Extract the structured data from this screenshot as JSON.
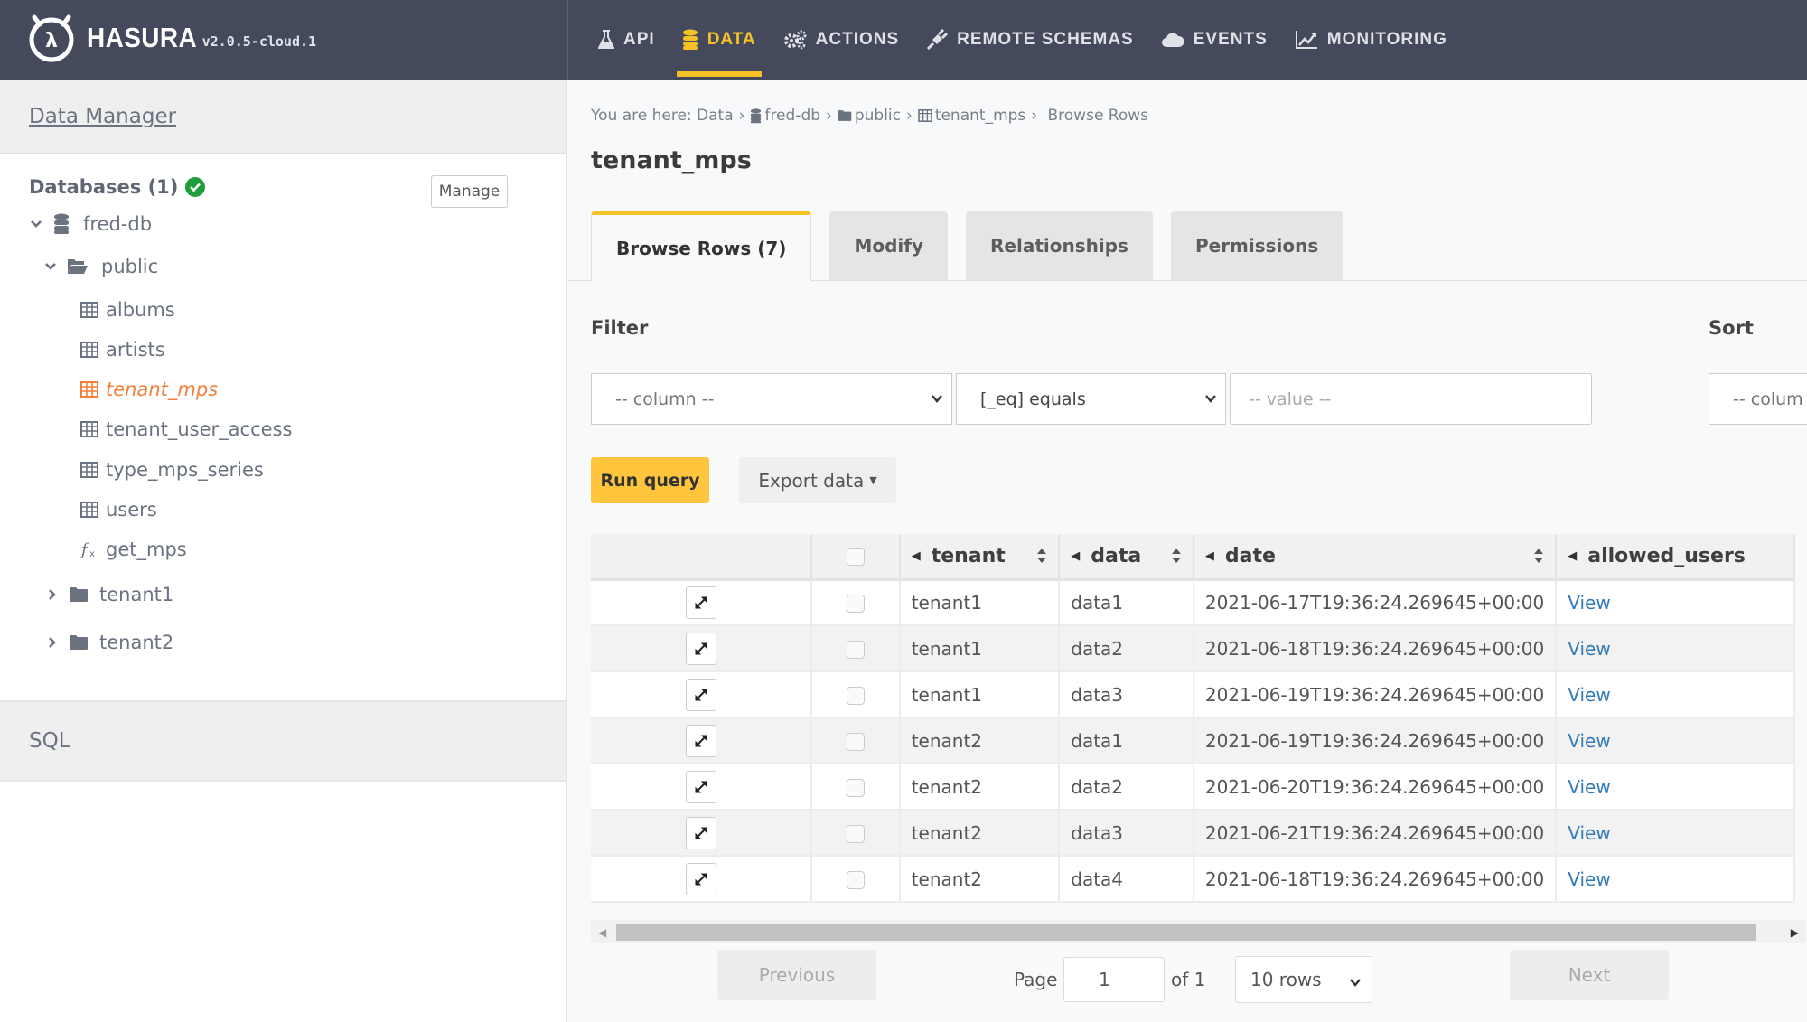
{
  "header": {
    "brand": "HASURA",
    "version": "v2.0.5-cloud.1",
    "nav": [
      {
        "label": "API",
        "icon": "flask-icon",
        "active": false
      },
      {
        "label": "DATA",
        "icon": "database-icon",
        "active": true
      },
      {
        "label": "ACTIONS",
        "icon": "cogs-icon",
        "active": false
      },
      {
        "label": "REMOTE SCHEMAS",
        "icon": "plug-icon",
        "active": false
      },
      {
        "label": "EVENTS",
        "icon": "cloud-icon",
        "active": false
      },
      {
        "label": "MONITORING",
        "icon": "line-chart-icon",
        "active": false
      }
    ],
    "accent_color": "#f5c124"
  },
  "sidebar": {
    "data_manager": "Data Manager",
    "databases_title": "Databases (1)",
    "manage_label": "Manage",
    "tree": {
      "database": "fred-db",
      "schema": "public",
      "items": [
        {
          "label": "albums",
          "type": "table",
          "active": false
        },
        {
          "label": "artists",
          "type": "table",
          "active": false
        },
        {
          "label": "tenant_mps",
          "type": "table",
          "active": true
        },
        {
          "label": "tenant_user_access",
          "type": "table",
          "active": false
        },
        {
          "label": "type_mps_series",
          "type": "table",
          "active": false
        },
        {
          "label": "users",
          "type": "table",
          "active": false
        },
        {
          "label": "get_mps",
          "type": "function",
          "active": false
        }
      ],
      "other_schemas": [
        "tenant1",
        "tenant2"
      ]
    },
    "sql_label": "SQL"
  },
  "breadcrumb": {
    "prefix": "You are here:",
    "items": [
      "Data",
      "fred-db",
      "public",
      "tenant_mps",
      "Browse Rows"
    ]
  },
  "page_title": "tenant_mps",
  "tabs": [
    {
      "label": "Browse Rows (7)",
      "active": true
    },
    {
      "label": "Modify",
      "active": false
    },
    {
      "label": "Relationships",
      "active": false
    },
    {
      "label": "Permissions",
      "active": false
    }
  ],
  "filter": {
    "label": "Filter",
    "column_placeholder": "-- column --",
    "operator_value": "[_eq] equals",
    "value_placeholder": "-- value --"
  },
  "sort": {
    "label": "Sort",
    "column_placeholder": "-- colum"
  },
  "actions": {
    "run_query": "Run query",
    "export_data": "Export data"
  },
  "table": {
    "columns": [
      "tenant",
      "data",
      "date",
      "allowed_users"
    ],
    "rows": [
      {
        "tenant": "tenant1",
        "data": "data1",
        "date": "2021-06-17T19:36:24.269645+00:00",
        "allowed_users": "View"
      },
      {
        "tenant": "tenant1",
        "data": "data2",
        "date": "2021-06-18T19:36:24.269645+00:00",
        "allowed_users": "View"
      },
      {
        "tenant": "tenant1",
        "data": "data3",
        "date": "2021-06-19T19:36:24.269645+00:00",
        "allowed_users": "View"
      },
      {
        "tenant": "tenant2",
        "data": "data1",
        "date": "2021-06-19T19:36:24.269645+00:00",
        "allowed_users": "View"
      },
      {
        "tenant": "tenant2",
        "data": "data2",
        "date": "2021-06-20T19:36:24.269645+00:00",
        "allowed_users": "View"
      },
      {
        "tenant": "tenant2",
        "data": "data3",
        "date": "2021-06-21T19:36:24.269645+00:00",
        "allowed_users": "View"
      },
      {
        "tenant": "tenant2",
        "data": "data4",
        "date": "2021-06-18T19:36:24.269645+00:00",
        "allowed_users": "View"
      }
    ]
  },
  "pagination": {
    "previous": "Previous",
    "page_label": "Page",
    "page_value": "1",
    "of_label": "of 1",
    "rows_option": "10 rows",
    "next": "Next"
  }
}
